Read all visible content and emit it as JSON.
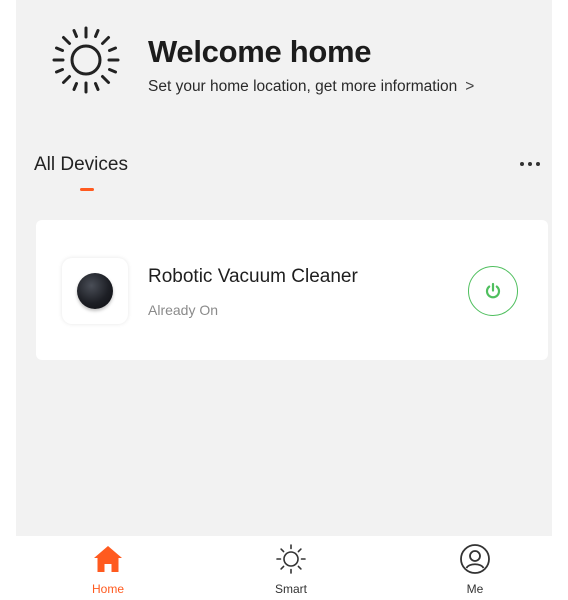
{
  "header": {
    "title": "Welcome home",
    "subtitle": "Set your home location, get more information",
    "chevron": ">",
    "icon": "sun-icon"
  },
  "devices": {
    "section_title": "All Devices",
    "more_icon": "more-dots-icon",
    "items": [
      {
        "name": "Robotic Vacuum Cleaner",
        "status": "Already On",
        "icon": "robot-vacuum-image",
        "power_icon": "power-icon",
        "power_color": "#4fbf5e"
      }
    ]
  },
  "tabbar": {
    "tabs": [
      {
        "label": "Home",
        "icon": "home-icon",
        "active": true
      },
      {
        "label": "Smart",
        "icon": "sun-icon",
        "active": false
      },
      {
        "label": "Me",
        "icon": "person-icon",
        "active": false
      }
    ]
  },
  "colors": {
    "accent": "#ff5a1f",
    "power_green": "#4fbf5e",
    "background": "#f2f2f2"
  }
}
